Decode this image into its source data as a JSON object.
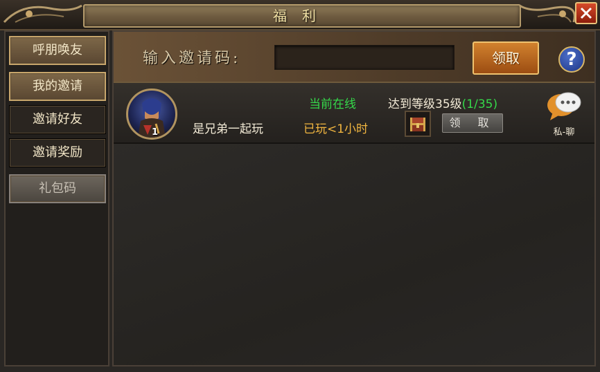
{
  "window": {
    "title": "福利",
    "close_icon": "close-x-icon"
  },
  "sidebar": {
    "items": [
      {
        "label": "呼朋唤友",
        "state": "active"
      },
      {
        "label": "我的邀请",
        "state": "selected"
      },
      {
        "label": "邀请好友",
        "state": "normal"
      },
      {
        "label": "邀请奖励",
        "state": "normal"
      },
      {
        "label": "礼包码",
        "state": "disabled"
      }
    ]
  },
  "invite": {
    "label": "输入邀请码:",
    "input_value": "",
    "claim_label": "领取",
    "help_icon": "question-mark-icon",
    "help_label": "?"
  },
  "friends": [
    {
      "name": "是兄弟一起玩",
      "avatar_level": "1",
      "status": "当前在线",
      "played": "已玩<1小时",
      "goal_text": "达到等级35级",
      "goal_progress": "(1/35)",
      "reward_icon": "treasure-chest-icon",
      "claim_label": "领 取",
      "chat_icon": "speech-bubble-icon",
      "chat_label": "私-聊"
    }
  ],
  "colors": {
    "online": "#35d94a",
    "played": "#f2b640",
    "accent": "#d1812e"
  }
}
